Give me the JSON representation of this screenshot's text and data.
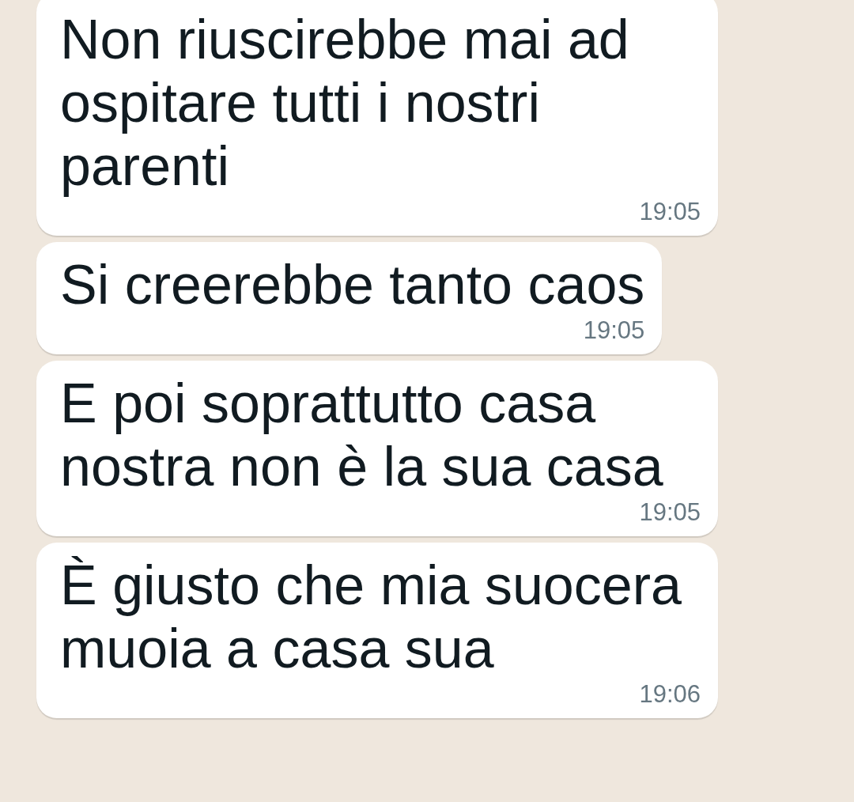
{
  "messages": [
    {
      "text": "Non riuscirebbe mai ad ospitare tutti i nostri parenti",
      "time": "19:05"
    },
    {
      "text": "Si creerebbe tanto caos",
      "time": "19:05"
    },
    {
      "text": "E poi soprattutto casa nostra non è la sua casa",
      "time": "19:05"
    },
    {
      "text": "È giusto che mia suocera muoia a casa sua",
      "time": "19:06"
    }
  ]
}
